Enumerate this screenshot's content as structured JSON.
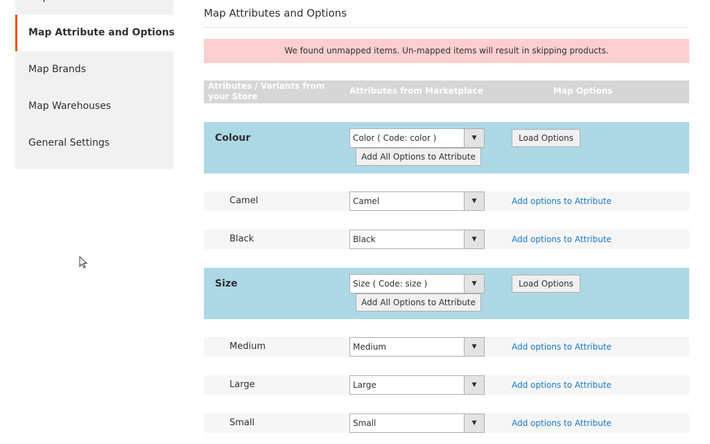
{
  "sidebar": {
    "items": [
      {
        "label": "Map Products"
      },
      {
        "label": "Map Attribute and Options"
      },
      {
        "label": "Map Brands"
      },
      {
        "label": "Map Warehouses"
      },
      {
        "label": "General Settings"
      }
    ]
  },
  "main": {
    "title": "Map Attributes and Options",
    "alert": "We found unmapped items. Un-mapped items will result in skipping products.",
    "headers": {
      "store": "Atributes / Variants from your Store",
      "marketplace": "Attributes from Marketplace",
      "options": "Map Options"
    },
    "groups": [
      {
        "name": "Colour",
        "select_value": "Color ( Code: color )",
        "add_all_label": "Add All Options to Attribute",
        "load_label": "Load Options",
        "options": [
          {
            "name": "Camel",
            "select_value": "Camel",
            "link": "Add options to Attribute"
          },
          {
            "name": "Black",
            "select_value": "Black",
            "link": "Add options to Attribute"
          }
        ]
      },
      {
        "name": "Size",
        "select_value": "Size ( Code: size )",
        "add_all_label": "Add All Options to Attribute",
        "load_label": "Load Options",
        "options": [
          {
            "name": "Medium",
            "select_value": "Medium",
            "link": "Add options to Attribute"
          },
          {
            "name": "Large",
            "select_value": "Large",
            "link": "Add options to Attribute"
          },
          {
            "name": "Small",
            "select_value": "Small",
            "link": "Add options to Attribute"
          }
        ]
      }
    ]
  },
  "icons": {
    "dropdown": "chevron-down-icon",
    "cursor": "mouse-pointer-icon"
  },
  "colors": {
    "accent": "#eb5202",
    "group_bg": "#add8e6",
    "alert_bg": "#fbcfcf",
    "link": "#1979c3",
    "header_bg": "#d6d6d6"
  }
}
